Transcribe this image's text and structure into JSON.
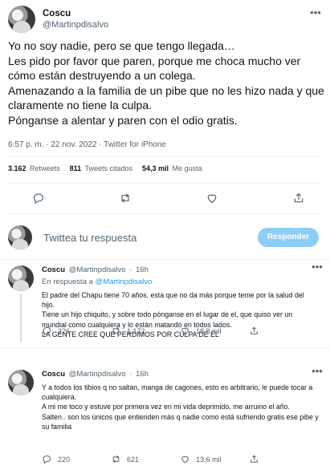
{
  "tweet": {
    "author_name": "Coscu",
    "author_handle": "@Martinpdisalvo",
    "text": "Yo no soy nadie, pero se que tengo llegada…\nLes pido por favor que paren, porque me choca mucho ver cómo están destruyendo a un colega.\nAmenazando a la familia de un pibe que no les hizo nada y que claramente no tiene la culpa.\nPónganse a alentar y paren con el odio gratis.",
    "meta": "6:57 p. m. · 22 nov. 2022 · Twitter for iPhone",
    "stats": {
      "retweets_count": "3.162",
      "retweets_label": "Retweets",
      "quotes_count": "811",
      "quotes_label": "Tweets citados",
      "likes_count": "54,3 mil",
      "likes_label": "Me gusta"
    },
    "icons": [
      "reply-icon",
      "retweet-icon",
      "like-icon",
      "share-icon"
    ]
  },
  "composer": {
    "placeholder": "Twittea tu respuesta",
    "button_label": "Responder"
  },
  "replies": [
    {
      "name": "Coscu",
      "handle": "@Martinpdisalvo",
      "time": "16h",
      "reply_to_label": "En respuesta a",
      "reply_to_handle": "@Martinpdisalvo",
      "text": "El padre del Chapu tiene 70 años, esta que no da más porque teme por la salud del hijo.\nTiene un hijo chiquito, y sobre todo pónganse en el lugar de el, que quiso ver un mundial como cualquiera y lo están matando en todos lados.\nLA GENTE CREE QUE PERDIMOS POR CULPA DE EL",
      "replies_count": "226",
      "retweets_count": "1.172",
      "likes_count": "18,8 mil"
    },
    {
      "name": "Coscu",
      "handle": "@Martinpdisalvo",
      "time": "16h",
      "text": "Y a todos los tibios q no saltan, manga de cagones, esto es arbitrario, le puede tocar a cualquiera.\nA mi me toco y estuve por primera vez en mi vida deprimido, me arruino el año.\nSalten.. son los únicos que entienden más q nadie como está sufriendo gratis ese pibe y su familia",
      "replies_count": "220",
      "retweets_count": "621",
      "likes_count": "13,6 mil"
    }
  ],
  "colors": {
    "text": "#0f1419",
    "secondary": "#536471",
    "accent": "#1d9bf0",
    "button_disabled": "#8ecdf7",
    "divider": "#eff3f4"
  }
}
